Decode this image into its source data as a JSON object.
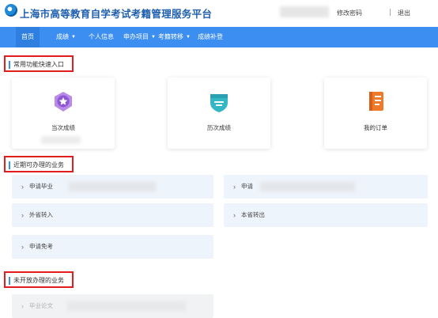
{
  "header": {
    "title": "上海市高等教育自学考试考籍管理服务平台",
    "change_password": "修改密码",
    "logout": "退出"
  },
  "nav": {
    "items": [
      {
        "label": "首页"
      },
      {
        "label": "成绩"
      },
      {
        "label": "个人信息"
      },
      {
        "label": "申办项目"
      },
      {
        "label": "考籍转移"
      },
      {
        "label": "成绩补登"
      }
    ]
  },
  "quick_entry": {
    "heading": "常用功能快速入口",
    "cards": [
      {
        "label": "当次成绩",
        "icon": "medal-icon",
        "color": "#9b59d6"
      },
      {
        "label": "历次成绩",
        "icon": "shield-icon",
        "color": "#2bb3c0"
      },
      {
        "label": "我的订单",
        "icon": "order-book-icon",
        "color": "#f07a2c"
      }
    ]
  },
  "recent_business": {
    "heading": "近期可办理的业务",
    "items": [
      {
        "label": "申请毕业"
      },
      {
        "label": "申请"
      },
      {
        "label": "外省转入"
      },
      {
        "label": "本省转出"
      },
      {
        "label": "申请免考"
      }
    ]
  },
  "unopened_business": {
    "heading": "未开放办理的业务",
    "items": [
      {
        "label": "毕业论文"
      }
    ]
  },
  "colors": {
    "nav_bg": "#3c8ef0",
    "title": "#1f5fae",
    "highlight_border": "#e31d1d",
    "business_bg": "#eef4fb"
  }
}
